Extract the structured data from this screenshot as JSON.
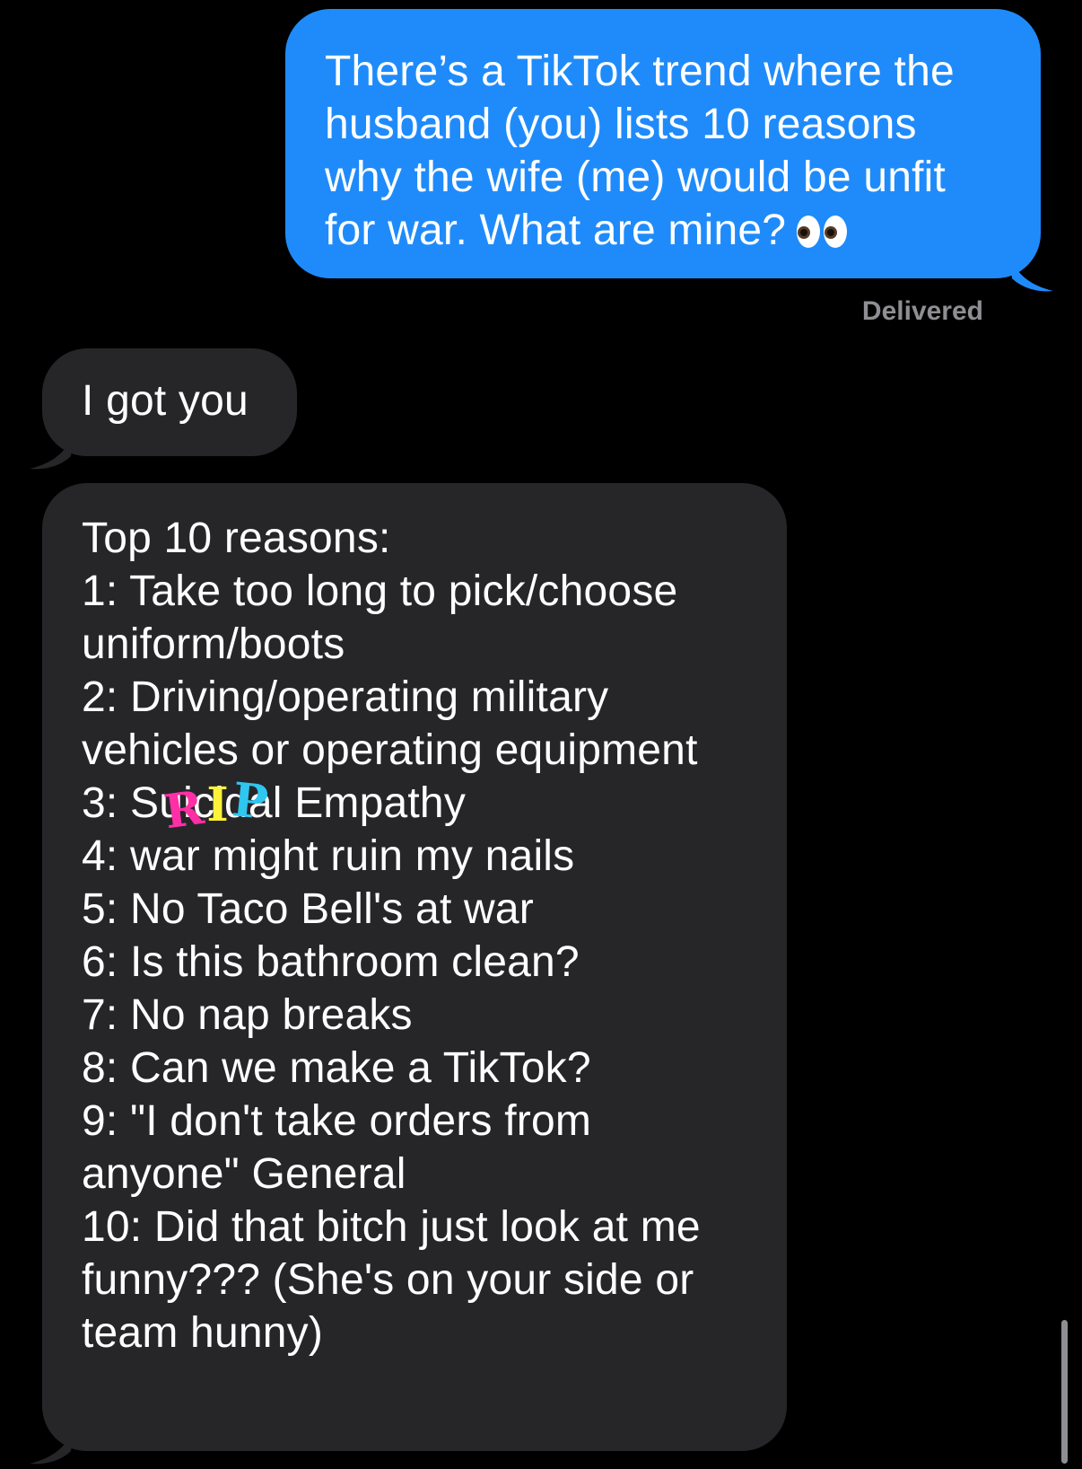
{
  "conversation": {
    "sent_message": {
      "lines": [
        "There’s a TikTok trend where the",
        "husband (you) lists 10 reasons",
        "why the wife (me) would be unfit",
        "for war. What are mine?"
      ],
      "emoji": "eyes-emoji",
      "status": "Delivered",
      "color": "#1f8bfb"
    },
    "received_messages": [
      {
        "text": "I got you"
      },
      {
        "lines": {
          "l0": "Top 10 reasons:",
          "l1": "1: Take too long to pick/choose",
          "l2": "uniform/boots",
          "l3": "2: Driving/operating military",
          "l4": "vehicles or operating equipment",
          "l5_prefix": "3: S",
          "l5_hidden": "uicidal",
          "l5_suffix": " Empathy",
          "l6": "4: war might ruin my nails",
          "l7": "5: No Taco Bell's at war",
          "l8": "6: Is this bathroom clean?",
          "l9": "7: No nap breaks",
          "l10": "8: Can we make a TikTok?",
          "l11": "9: \"I don't take orders from",
          "l12": "anyone\" General",
          "l13": "10: Did that bitch just look at me",
          "l14": "funny??? (She's on your side or",
          "l15": "team hunny)"
        },
        "sticker": {
          "letters": [
            "R",
            "I",
            "P"
          ],
          "colors": [
            "#ff2fa6",
            "#fff23a",
            "#2fc6f0"
          ]
        },
        "color": "#262629"
      }
    ]
  }
}
